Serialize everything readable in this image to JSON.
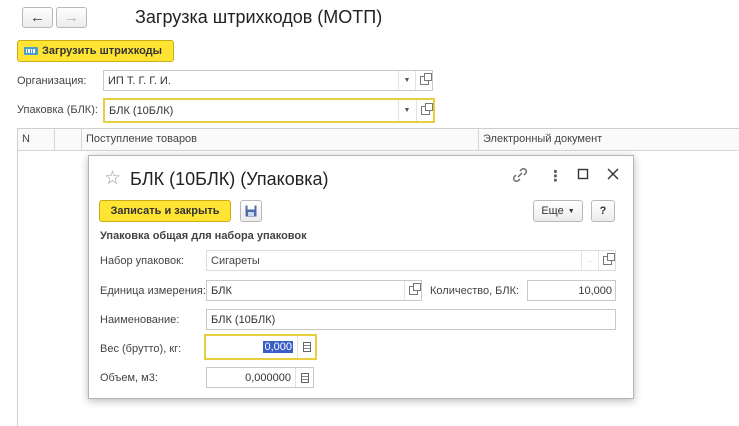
{
  "nav": {
    "back_icon": "arrow-left-icon",
    "forward_icon": "arrow-right-icon"
  },
  "window": {
    "title": "Загрузка штрихкодов (МОТП)"
  },
  "toolbar": {
    "load_label": "Загрузить штрихкоды"
  },
  "form": {
    "organization_label": "Организация:",
    "organization_value": "ИП Т.    Г.          Г.         И.",
    "package_label": "Упаковка (БЛК):",
    "package_value": "БЛК (10БЛК)"
  },
  "grid": {
    "columns": [
      "N",
      "",
      "Поступление товаров",
      "Электронный документ"
    ]
  },
  "dialog": {
    "title": "БЛК (10БЛК) (Упаковка)",
    "save_close_label": "Записать и закрыть",
    "more_label": "Еще",
    "help_label": "?",
    "section_title": "Упаковка общая для набора упаковок",
    "package_set_label": "Набор упаковок:",
    "package_set_value": "Сигареты",
    "unit_label": "Единица измерения:",
    "unit_value": "БЛК",
    "quantity_label": "Количество, БЛК:",
    "quantity_value": "10,000",
    "name_label": "Наименование:",
    "name_value": "БЛК (10БЛК)",
    "weight_label": "Вес (брутто), кг:",
    "weight_value": "0,000",
    "volume_label": "Объем, м3:",
    "volume_value": "0,000000"
  },
  "colors": {
    "accent_yellow": "#ffe434",
    "focus_border": "#e8cf3f",
    "selection": "#3a5ec7"
  }
}
